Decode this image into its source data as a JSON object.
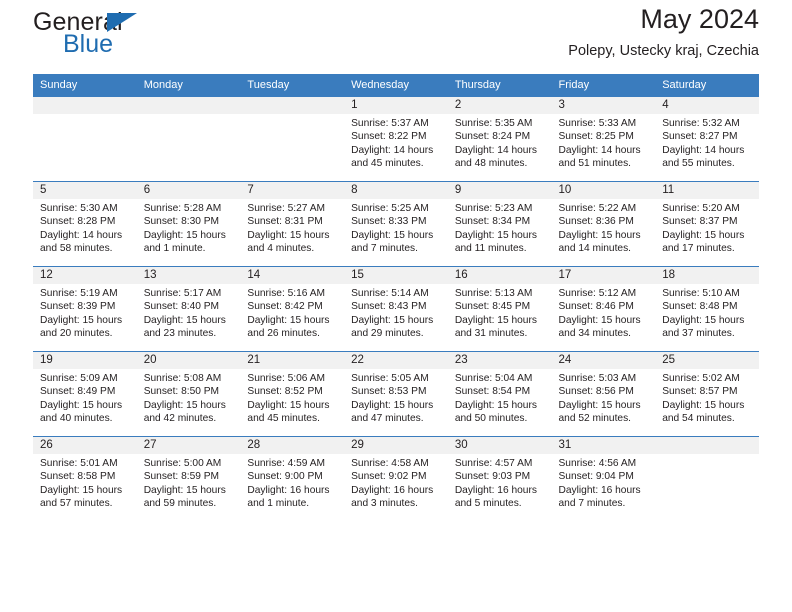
{
  "brand": {
    "name_part1": "General",
    "name_part2": "Blue",
    "triangle_color": "#1f6cb0",
    "text_color": "#231f20"
  },
  "header": {
    "title": "May 2024",
    "subtitle": "Polepy, Ustecky kraj, Czechia"
  },
  "theme": {
    "header_bg": "#3a7cbe",
    "header_text": "#ffffff",
    "daynum_band_bg": "#f1f1f1",
    "week_separator": "#3a7cbe",
    "body_text": "#231f20"
  },
  "calendar": {
    "weekday_headers": [
      "Sunday",
      "Monday",
      "Tuesday",
      "Wednesday",
      "Thursday",
      "Friday",
      "Saturday"
    ],
    "weeks": [
      [
        {
          "day": "",
          "sunrise": "",
          "sunset": "",
          "daylight": ""
        },
        {
          "day": "",
          "sunrise": "",
          "sunset": "",
          "daylight": ""
        },
        {
          "day": "",
          "sunrise": "",
          "sunset": "",
          "daylight": ""
        },
        {
          "day": "1",
          "sunrise": "Sunrise: 5:37 AM",
          "sunset": "Sunset: 8:22 PM",
          "daylight": "Daylight: 14 hours and 45 minutes."
        },
        {
          "day": "2",
          "sunrise": "Sunrise: 5:35 AM",
          "sunset": "Sunset: 8:24 PM",
          "daylight": "Daylight: 14 hours and 48 minutes."
        },
        {
          "day": "3",
          "sunrise": "Sunrise: 5:33 AM",
          "sunset": "Sunset: 8:25 PM",
          "daylight": "Daylight: 14 hours and 51 minutes."
        },
        {
          "day": "4",
          "sunrise": "Sunrise: 5:32 AM",
          "sunset": "Sunset: 8:27 PM",
          "daylight": "Daylight: 14 hours and 55 minutes."
        }
      ],
      [
        {
          "day": "5",
          "sunrise": "Sunrise: 5:30 AM",
          "sunset": "Sunset: 8:28 PM",
          "daylight": "Daylight: 14 hours and 58 minutes."
        },
        {
          "day": "6",
          "sunrise": "Sunrise: 5:28 AM",
          "sunset": "Sunset: 8:30 PM",
          "daylight": "Daylight: 15 hours and 1 minute."
        },
        {
          "day": "7",
          "sunrise": "Sunrise: 5:27 AM",
          "sunset": "Sunset: 8:31 PM",
          "daylight": "Daylight: 15 hours and 4 minutes."
        },
        {
          "day": "8",
          "sunrise": "Sunrise: 5:25 AM",
          "sunset": "Sunset: 8:33 PM",
          "daylight": "Daylight: 15 hours and 7 minutes."
        },
        {
          "day": "9",
          "sunrise": "Sunrise: 5:23 AM",
          "sunset": "Sunset: 8:34 PM",
          "daylight": "Daylight: 15 hours and 11 minutes."
        },
        {
          "day": "10",
          "sunrise": "Sunrise: 5:22 AM",
          "sunset": "Sunset: 8:36 PM",
          "daylight": "Daylight: 15 hours and 14 minutes."
        },
        {
          "day": "11",
          "sunrise": "Sunrise: 5:20 AM",
          "sunset": "Sunset: 8:37 PM",
          "daylight": "Daylight: 15 hours and 17 minutes."
        }
      ],
      [
        {
          "day": "12",
          "sunrise": "Sunrise: 5:19 AM",
          "sunset": "Sunset: 8:39 PM",
          "daylight": "Daylight: 15 hours and 20 minutes."
        },
        {
          "day": "13",
          "sunrise": "Sunrise: 5:17 AM",
          "sunset": "Sunset: 8:40 PM",
          "daylight": "Daylight: 15 hours and 23 minutes."
        },
        {
          "day": "14",
          "sunrise": "Sunrise: 5:16 AM",
          "sunset": "Sunset: 8:42 PM",
          "daylight": "Daylight: 15 hours and 26 minutes."
        },
        {
          "day": "15",
          "sunrise": "Sunrise: 5:14 AM",
          "sunset": "Sunset: 8:43 PM",
          "daylight": "Daylight: 15 hours and 29 minutes."
        },
        {
          "day": "16",
          "sunrise": "Sunrise: 5:13 AM",
          "sunset": "Sunset: 8:45 PM",
          "daylight": "Daylight: 15 hours and 31 minutes."
        },
        {
          "day": "17",
          "sunrise": "Sunrise: 5:12 AM",
          "sunset": "Sunset: 8:46 PM",
          "daylight": "Daylight: 15 hours and 34 minutes."
        },
        {
          "day": "18",
          "sunrise": "Sunrise: 5:10 AM",
          "sunset": "Sunset: 8:48 PM",
          "daylight": "Daylight: 15 hours and 37 minutes."
        }
      ],
      [
        {
          "day": "19",
          "sunrise": "Sunrise: 5:09 AM",
          "sunset": "Sunset: 8:49 PM",
          "daylight": "Daylight: 15 hours and 40 minutes."
        },
        {
          "day": "20",
          "sunrise": "Sunrise: 5:08 AM",
          "sunset": "Sunset: 8:50 PM",
          "daylight": "Daylight: 15 hours and 42 minutes."
        },
        {
          "day": "21",
          "sunrise": "Sunrise: 5:06 AM",
          "sunset": "Sunset: 8:52 PM",
          "daylight": "Daylight: 15 hours and 45 minutes."
        },
        {
          "day": "22",
          "sunrise": "Sunrise: 5:05 AM",
          "sunset": "Sunset: 8:53 PM",
          "daylight": "Daylight: 15 hours and 47 minutes."
        },
        {
          "day": "23",
          "sunrise": "Sunrise: 5:04 AM",
          "sunset": "Sunset: 8:54 PM",
          "daylight": "Daylight: 15 hours and 50 minutes."
        },
        {
          "day": "24",
          "sunrise": "Sunrise: 5:03 AM",
          "sunset": "Sunset: 8:56 PM",
          "daylight": "Daylight: 15 hours and 52 minutes."
        },
        {
          "day": "25",
          "sunrise": "Sunrise: 5:02 AM",
          "sunset": "Sunset: 8:57 PM",
          "daylight": "Daylight: 15 hours and 54 minutes."
        }
      ],
      [
        {
          "day": "26",
          "sunrise": "Sunrise: 5:01 AM",
          "sunset": "Sunset: 8:58 PM",
          "daylight": "Daylight: 15 hours and 57 minutes."
        },
        {
          "day": "27",
          "sunrise": "Sunrise: 5:00 AM",
          "sunset": "Sunset: 8:59 PM",
          "daylight": "Daylight: 15 hours and 59 minutes."
        },
        {
          "day": "28",
          "sunrise": "Sunrise: 4:59 AM",
          "sunset": "Sunset: 9:00 PM",
          "daylight": "Daylight: 16 hours and 1 minute."
        },
        {
          "day": "29",
          "sunrise": "Sunrise: 4:58 AM",
          "sunset": "Sunset: 9:02 PM",
          "daylight": "Daylight: 16 hours and 3 minutes."
        },
        {
          "day": "30",
          "sunrise": "Sunrise: 4:57 AM",
          "sunset": "Sunset: 9:03 PM",
          "daylight": "Daylight: 16 hours and 5 minutes."
        },
        {
          "day": "31",
          "sunrise": "Sunrise: 4:56 AM",
          "sunset": "Sunset: 9:04 PM",
          "daylight": "Daylight: 16 hours and 7 minutes."
        },
        {
          "day": "",
          "sunrise": "",
          "sunset": "",
          "daylight": ""
        }
      ]
    ]
  }
}
